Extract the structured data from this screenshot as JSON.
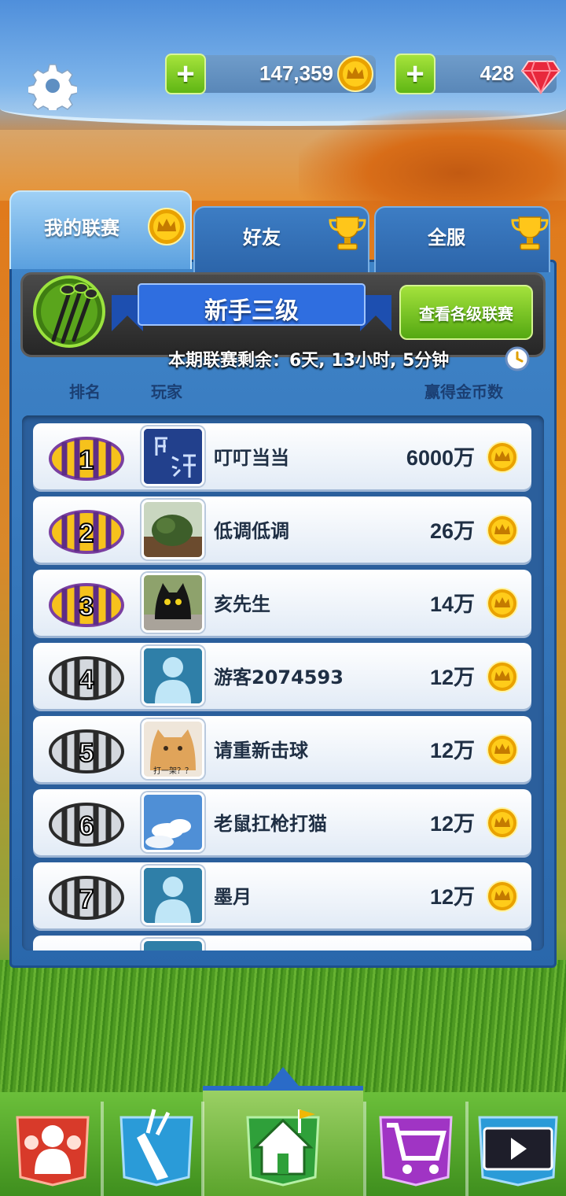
{
  "header": {
    "coins": "147,359",
    "gems": "428",
    "icons": [
      "gear-icon",
      "plus-icon",
      "crown-coin-icon",
      "ruby-gem-icon"
    ]
  },
  "tabs": [
    {
      "label": "我的联赛",
      "icon": "crown-coin-icon",
      "active": true
    },
    {
      "label": "好友",
      "icon": "trophy-icon",
      "active": false
    },
    {
      "label": "全服",
      "icon": "trophy-icon",
      "active": false
    }
  ],
  "league": {
    "name": "新手三级",
    "view_button": "查看各级联赛",
    "countdown": "本期联赛剩余：6天, 13小时, 5分钟"
  },
  "columns": {
    "rank": "排名",
    "player": "玩家",
    "coins": "赢得金币数"
  },
  "rows": [
    {
      "rank": "1",
      "name": "叮叮当当",
      "score": "6000万",
      "avatar": "calligraphy"
    },
    {
      "rank": "2",
      "name": "低调低调",
      "score": "26万",
      "avatar": "bush"
    },
    {
      "rank": "3",
      "name": "亥先生",
      "score": "14万",
      "avatar": "black-cat"
    },
    {
      "rank": "4",
      "name": "游客2074593",
      "score": "12万",
      "avatar": "default"
    },
    {
      "rank": "5",
      "name": "请重新击球",
      "score": "12万",
      "avatar": "orange-cat",
      "avatar_caption": "打一架？？"
    },
    {
      "rank": "6",
      "name": "老鼠扛枪打猫",
      "score": "12万",
      "avatar": "sky"
    },
    {
      "rank": "7",
      "name": "墨月",
      "score": "12万",
      "avatar": "default"
    }
  ],
  "colors": {
    "gold": "#f2b705",
    "green_button": "#6cc21a",
    "panel_blue": "#2f6fb3",
    "gem_red": "#e8283c"
  },
  "nav": [
    "friends-icon",
    "golf-bag-icon",
    "home-icon",
    "shop-cart-icon",
    "video-replay-icon"
  ]
}
